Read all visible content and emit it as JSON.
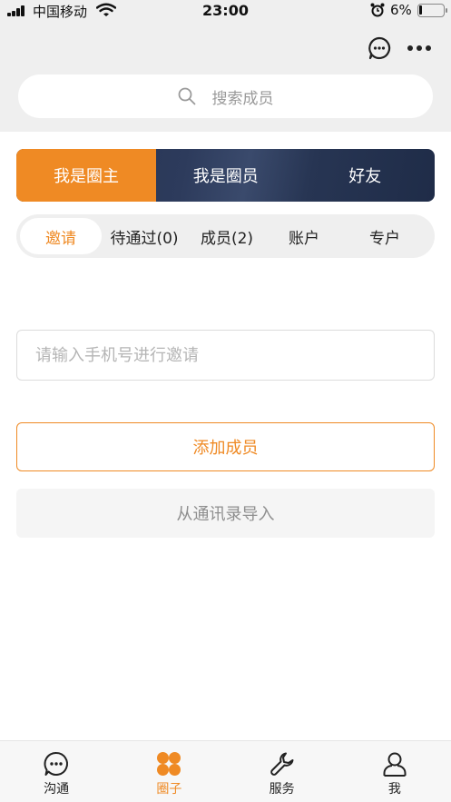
{
  "status_bar": {
    "carrier": "中国移动",
    "time": "23:00",
    "battery": "6%"
  },
  "header": {
    "icons": [
      "chat-bubble-icon",
      "more-icon"
    ]
  },
  "search": {
    "placeholder": "搜索成员"
  },
  "role_tabs": [
    {
      "label": "我是圈主",
      "active": true
    },
    {
      "label": "我是圈员",
      "active": false
    },
    {
      "label": "好友",
      "active": false
    }
  ],
  "sub_tabs": [
    {
      "label": "邀请",
      "active": true
    },
    {
      "label": "待通过(0)",
      "active": false
    },
    {
      "label": "成员(2)",
      "active": false
    },
    {
      "label": "账户",
      "active": false
    },
    {
      "label": "专户",
      "active": false
    }
  ],
  "invite": {
    "phone_placeholder": "请输入手机号进行邀请",
    "add_label": "添加成员",
    "import_label": "从通讯录导入"
  },
  "bottom_nav": [
    {
      "label": "沟通",
      "icon": "chat-icon",
      "active": false
    },
    {
      "label": "圈子",
      "icon": "circles-icon",
      "active": true
    },
    {
      "label": "服务",
      "icon": "wrench-icon",
      "active": false
    },
    {
      "label": "我",
      "icon": "person-icon",
      "active": false
    }
  ],
  "colors": {
    "accent": "#ef8a24",
    "navy": "#26344f",
    "gray_bg": "#efefef"
  }
}
